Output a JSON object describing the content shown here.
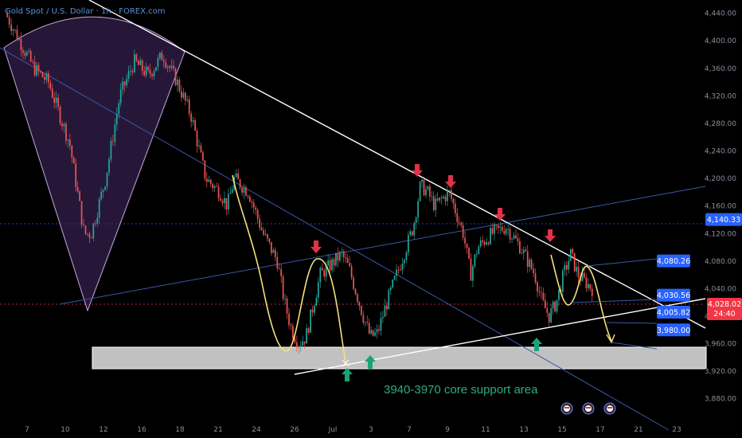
{
  "header": {
    "title": "Gold Spot / U.S. Dollar · 1h · FOREX.com"
  },
  "colors": {
    "background": "#000000",
    "up_candle": "#26a69a",
    "down_candle": "#ef5350",
    "trendline": "#ffffff",
    "channel_line": "#3d56a6",
    "projection_path": "#f3e27a",
    "arrow_down": "#e0334a",
    "arrow_up": "#1aa37a",
    "support_zone": "#cfcfcf",
    "price_label": "#2962ff",
    "current_price_label": "#f23645",
    "annotation": "#2faa86"
  },
  "chart_data": {
    "type": "candlestick",
    "title": "Gold Spot / U.S. Dollar · 1h · FOREX.com",
    "ylim": [
      3860,
      4450
    ],
    "y_ticks": [
      "4,440.00",
      "4,400.00",
      "4,360.00",
      "4,320.00",
      "4,280.00",
      "4,240.00",
      "4,200.00",
      "4,160.00",
      "4,120.00",
      "4,080.00",
      "4,040.00",
      "4,000.00",
      "3,960.00",
      "3,920.00",
      "3,880.00"
    ],
    "x_ticks": [
      "7",
      "10",
      "12",
      "16",
      "18",
      "21",
      "24",
      "26",
      "Jul",
      "3",
      "7",
      "9",
      "11",
      "13",
      "15",
      "17",
      "21",
      "23"
    ],
    "price_path": [
      [
        0,
        4440
      ],
      [
        2,
        4400
      ],
      [
        4,
        4360
      ],
      [
        6,
        4340
      ],
      [
        9,
        4250
      ],
      [
        11,
        4120
      ],
      [
        12,
        4120
      ],
      [
        14,
        4200
      ],
      [
        16,
        4320
      ],
      [
        18,
        4370
      ],
      [
        20,
        4350
      ],
      [
        22,
        4380
      ],
      [
        24,
        4340
      ],
      [
        26,
        4290
      ],
      [
        28,
        4200
      ],
      [
        30,
        4180
      ],
      [
        31,
        4160
      ],
      [
        32,
        4200
      ],
      [
        34,
        4180
      ],
      [
        36,
        4120
      ],
      [
        38,
        4080
      ],
      [
        39,
        4020
      ],
      [
        40,
        3980
      ],
      [
        41,
        3960
      ],
      [
        42,
        3970
      ],
      [
        44,
        4060
      ],
      [
        46,
        4080
      ],
      [
        47,
        4090
      ],
      [
        48,
        4070
      ],
      [
        50,
        4000
      ],
      [
        51,
        3970
      ],
      [
        52,
        3975
      ],
      [
        53,
        4010
      ],
      [
        55,
        4070
      ],
      [
        57,
        4130
      ],
      [
        58,
        4190
      ],
      [
        59,
        4180
      ],
      [
        60,
        4160
      ],
      [
        62,
        4180
      ],
      [
        63,
        4150
      ],
      [
        64,
        4120
      ],
      [
        65,
        4060
      ],
      [
        66,
        4100
      ],
      [
        68,
        4120
      ],
      [
        70,
        4130
      ],
      [
        72,
        4100
      ],
      [
        74,
        4060
      ],
      [
        75,
        4020
      ],
      [
        76,
        4000
      ],
      [
        77,
        4020
      ],
      [
        78,
        4060
      ],
      [
        79,
        4090
      ],
      [
        80,
        4060
      ],
      [
        81,
        4050
      ],
      [
        82,
        4040
      ]
    ],
    "price_labels": [
      {
        "text": "4,140.33",
        "value": 4140.33
      },
      {
        "text": "4,080.26",
        "value": 4080.26
      },
      {
        "text": "4,030.56",
        "value": 4030.56
      },
      {
        "text": "4,005.82",
        "value": 4005.82
      },
      {
        "text": "3,980.00",
        "value": 3980
      }
    ],
    "current_price": {
      "price": "4,028.02",
      "countdown": "24:40",
      "value": 4028.02
    },
    "support_zone": {
      "low": 3940,
      "high": 3970
    },
    "annotation": "3940-3970 core support area",
    "down_arrows": 5,
    "up_arrows": 3
  }
}
